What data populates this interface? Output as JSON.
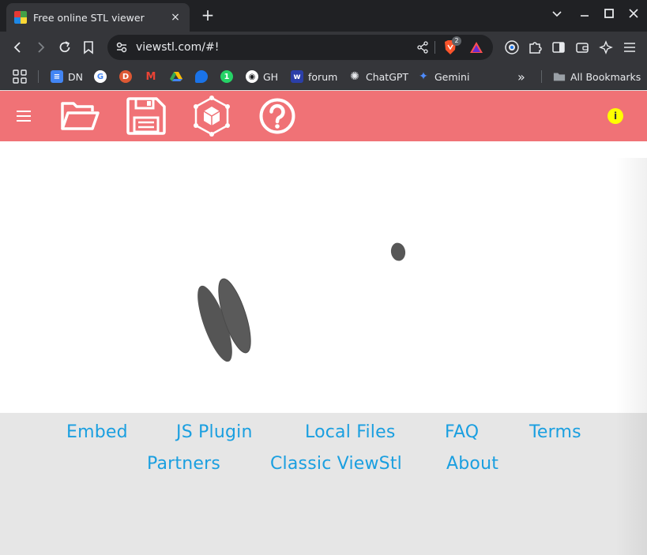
{
  "browser": {
    "tab_title": "Free online STL viewer",
    "tab_close": "×",
    "new_tab": "+",
    "url": "viewstl.com/#!",
    "brave_badge": "2"
  },
  "bookmarks": [
    {
      "label": "DN",
      "icon": "google-docs-icon",
      "color": "#4285f4"
    },
    {
      "label": "",
      "icon": "google-icon",
      "color": "#ffffff"
    },
    {
      "label": "",
      "icon": "duckduckgo-icon",
      "color": "#de5833"
    },
    {
      "label": "",
      "icon": "gmail-icon",
      "color": "#ea4335"
    },
    {
      "label": "",
      "icon": "google-drive-icon",
      "color": "#fbbc04"
    },
    {
      "label": "",
      "icon": "messages-icon",
      "color": "#1a73e8"
    },
    {
      "label": "",
      "icon": "whatsapp-icon",
      "color": "#25d366"
    },
    {
      "label": "GH",
      "icon": "github-icon",
      "color": "#ffffff"
    },
    {
      "label": "forum",
      "icon": "forum-icon",
      "color": "#3b5bdb"
    },
    {
      "label": "ChatGPT",
      "icon": "chatgpt-icon",
      "color": "#ffffff"
    },
    {
      "label": "Gemini",
      "icon": "gemini-icon",
      "color": "#4e8cff"
    }
  ],
  "all_bookmarks": "All Bookmarks",
  "overflow": "»",
  "app": {
    "header_color": "#f07276",
    "info_label": "i",
    "menu_icon": "hamburger-icon",
    "tools": [
      "folder-open-icon",
      "save-icon",
      "cube-view-icon",
      "help-icon"
    ]
  },
  "footer": {
    "row1": [
      "Embed",
      "JS Plugin",
      "Local Files",
      "FAQ",
      "Terms"
    ],
    "row2": [
      "Partners",
      "Classic ViewStl",
      "About"
    ]
  }
}
